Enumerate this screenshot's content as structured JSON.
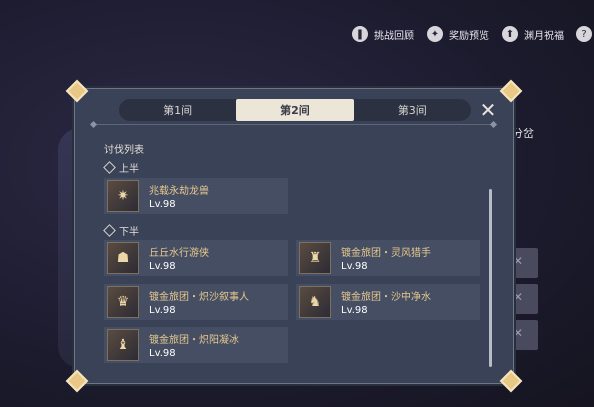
{
  "top_bar": {
    "buttons": [
      {
        "icon": "book-icon",
        "label": "挑战回顾"
      },
      {
        "icon": "star-icon",
        "label": "奖励预览"
      },
      {
        "icon": "arrow-up-icon",
        "label": "渊月祝福"
      }
    ],
    "help_icon": "?"
  },
  "background": {
    "right_text": "分岔"
  },
  "dialog": {
    "tabs": [
      "第1间",
      "第2间",
      "第3间"
    ],
    "active_tab": 1,
    "close_symbol": "✕",
    "list_title": "讨伐列表",
    "upper_half": {
      "label": "上半",
      "enemies": [
        {
          "name": "兆载永劫龙兽",
          "level": "Lv.98",
          "glyph": "✷"
        }
      ]
    },
    "lower_half": {
      "label": "下半",
      "enemies": [
        {
          "name": "丘丘水行游侠",
          "level": "Lv.98",
          "glyph": "☗"
        },
        {
          "name": "镀金旅团・灵风猎手",
          "level": "Lv.98",
          "glyph": "♜"
        },
        {
          "name": "镀金旅团・炽沙叙事人",
          "level": "Lv.98",
          "glyph": "♛"
        },
        {
          "name": "镀金旅团・沙中净水",
          "level": "Lv.98",
          "glyph": "♞"
        },
        {
          "name": "镀金旅团・炽阳凝冰",
          "level": "Lv.98",
          "glyph": "♝"
        }
      ]
    }
  },
  "colors": {
    "dialog_bg": "#3a4257",
    "entry_bg": "#454e63",
    "name_gold": "#e6c98f",
    "active_tab": "#ece6d8"
  }
}
